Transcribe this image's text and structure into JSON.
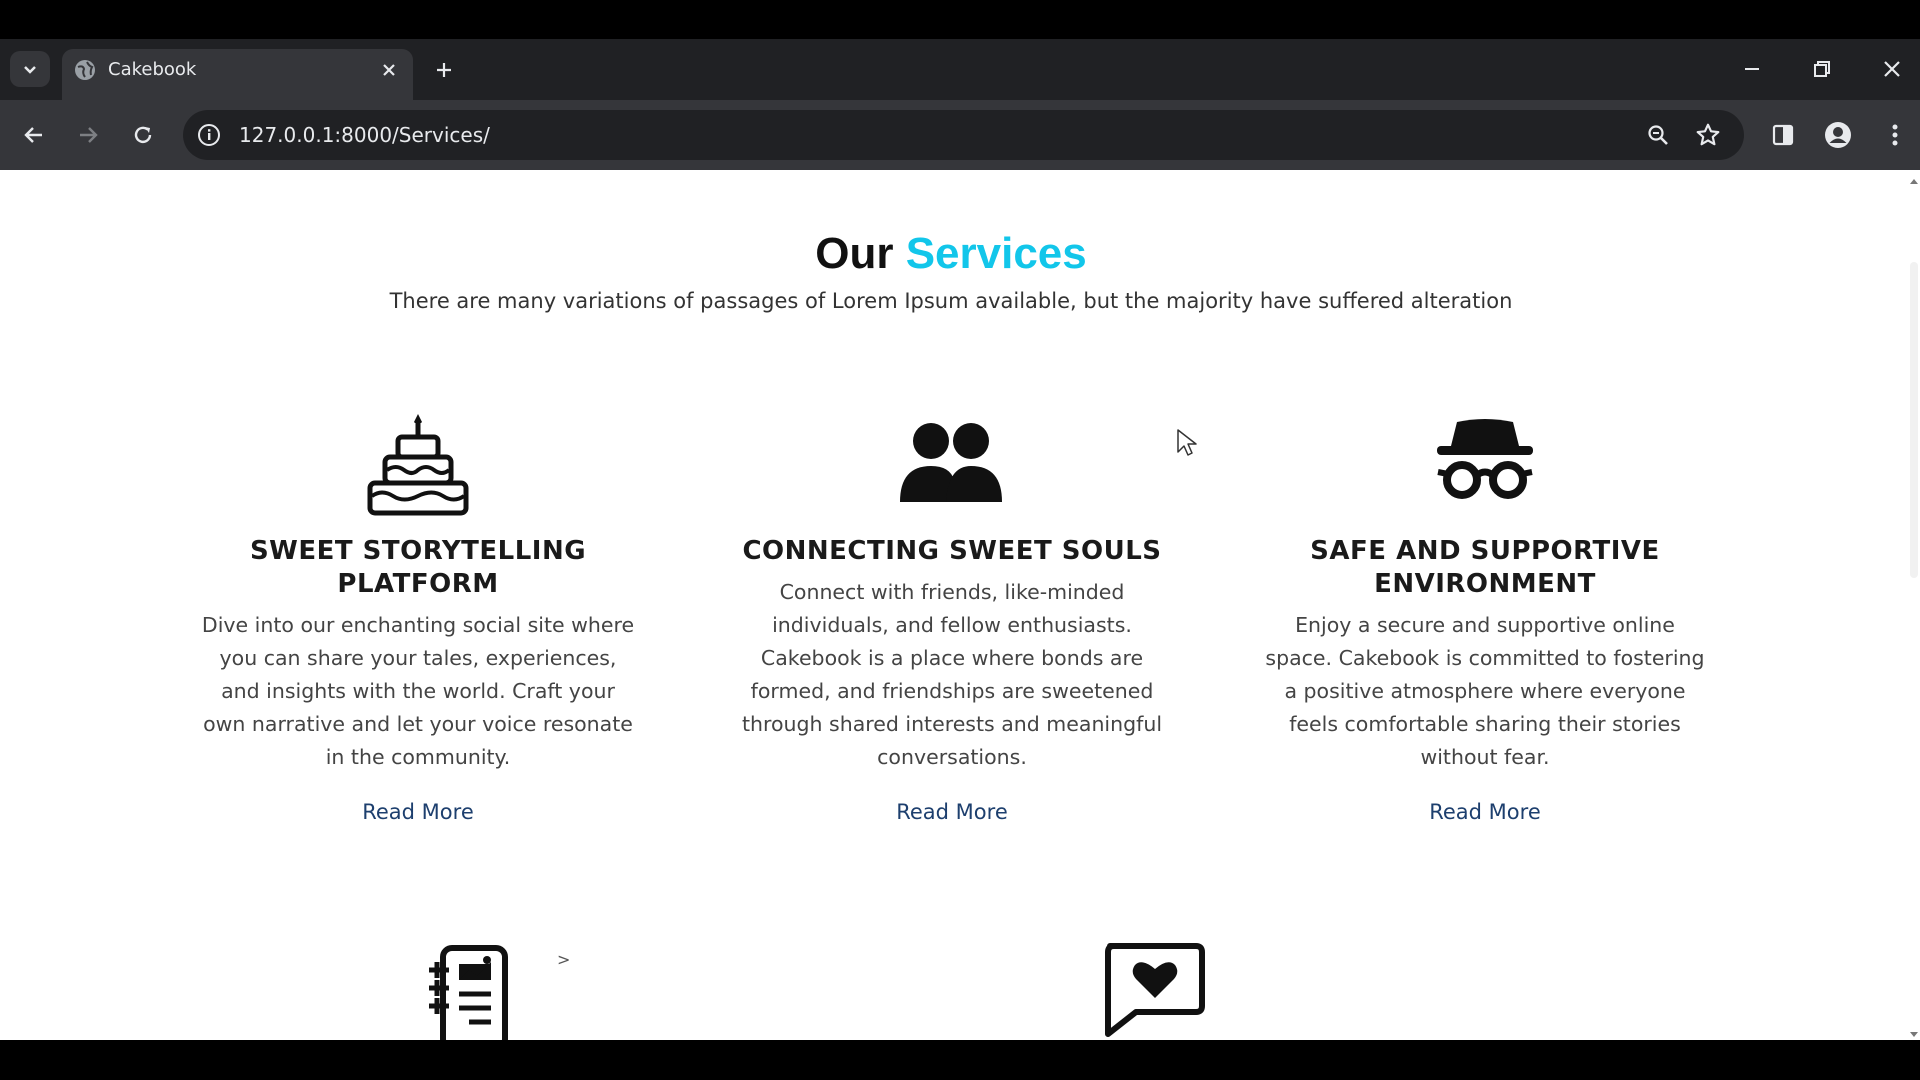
{
  "browser": {
    "tab_title": "Cakebook",
    "url": "127.0.0.1:8000/Services/"
  },
  "page": {
    "heading_prefix": "Our",
    "heading_accent": "Services",
    "subtitle": "There are many variations of passages of Lorem Ipsum available, but the majority have suffered alteration",
    "cards": [
      {
        "icon": "birthday-cake-icon",
        "title": "SWEET STORYTELLING PLATFORM",
        "text": "Dive into our enchanting social site where you can share your tales, experiences, and insights with the world. Craft your own narrative and let your voice resonate in the community.",
        "link": "Read More"
      },
      {
        "icon": "user-group-icon",
        "title": "CONNECTING SWEET SOULS",
        "text": "Connect with friends, like-minded individuals, and fellow enthusiasts. Cakebook is a place where bonds are formed, and friendships are sweetened through shared interests and meaningful conversations.",
        "link": "Read More"
      },
      {
        "icon": "incognito-icon",
        "title": "SAFE AND SUPPORTIVE ENVIRONMENT",
        "text": "Enjoy a secure and supportive online space. Cakebook is committed to fostering a positive atmosphere where everyone feels comfortable sharing their stories without fear.",
        "link": "Read More"
      }
    ],
    "stray_text": ">",
    "lower_icons": [
      "notebook-icon",
      "message-heart-icon"
    ]
  },
  "colors": {
    "accent": "#12c6ea",
    "link": "#1d3f6e"
  }
}
